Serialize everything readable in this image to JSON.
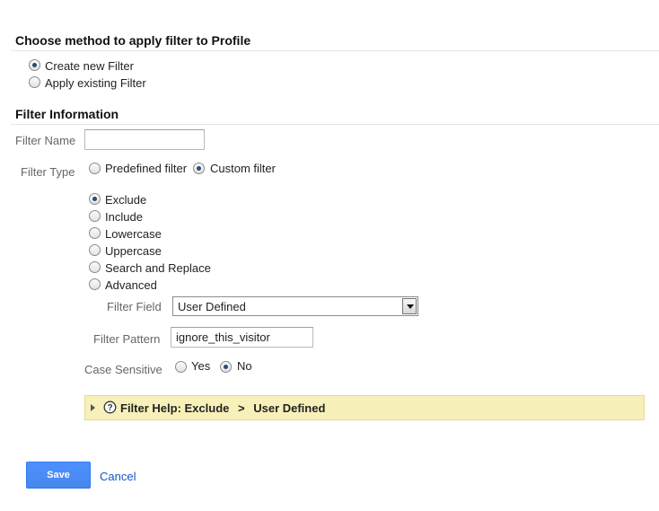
{
  "method": {
    "title": "Choose method to apply filter to Profile",
    "options": [
      {
        "label": "Create new Filter",
        "checked": true
      },
      {
        "label": "Apply existing Filter",
        "checked": false
      }
    ]
  },
  "info": {
    "title": "Filter Information",
    "filter_name": {
      "label": "Filter Name",
      "value": ""
    },
    "filter_type": {
      "label": "Filter Type",
      "options": [
        {
          "label": "Predefined filter",
          "checked": false
        },
        {
          "label": "Custom filter",
          "checked": true
        }
      ]
    },
    "custom_options": [
      {
        "label": "Exclude",
        "checked": true
      },
      {
        "label": "Include",
        "checked": false
      },
      {
        "label": "Lowercase",
        "checked": false
      },
      {
        "label": "Uppercase",
        "checked": false
      },
      {
        "label": "Search and Replace",
        "checked": false
      },
      {
        "label": "Advanced",
        "checked": false
      }
    ],
    "filter_field": {
      "label": "Filter Field",
      "value": "User Defined"
    },
    "filter_pattern": {
      "label": "Filter Pattern",
      "value": "ignore_this_visitor"
    },
    "case_sensitive": {
      "label": "Case Sensitive",
      "options": [
        {
          "label": "Yes",
          "checked": false
        },
        {
          "label": "No",
          "checked": true
        }
      ]
    }
  },
  "help": {
    "prefix": "Filter Help: Exclude",
    "separator": ">",
    "suffix": "User Defined",
    "icon": "question-circle-icon",
    "expand_icon": "triangle-right-icon",
    "background": "#f7f1b9"
  },
  "actions": {
    "save_label": "Save",
    "cancel_label": "Cancel",
    "save_color": "#4d90fe",
    "link_color": "#1155cc"
  }
}
